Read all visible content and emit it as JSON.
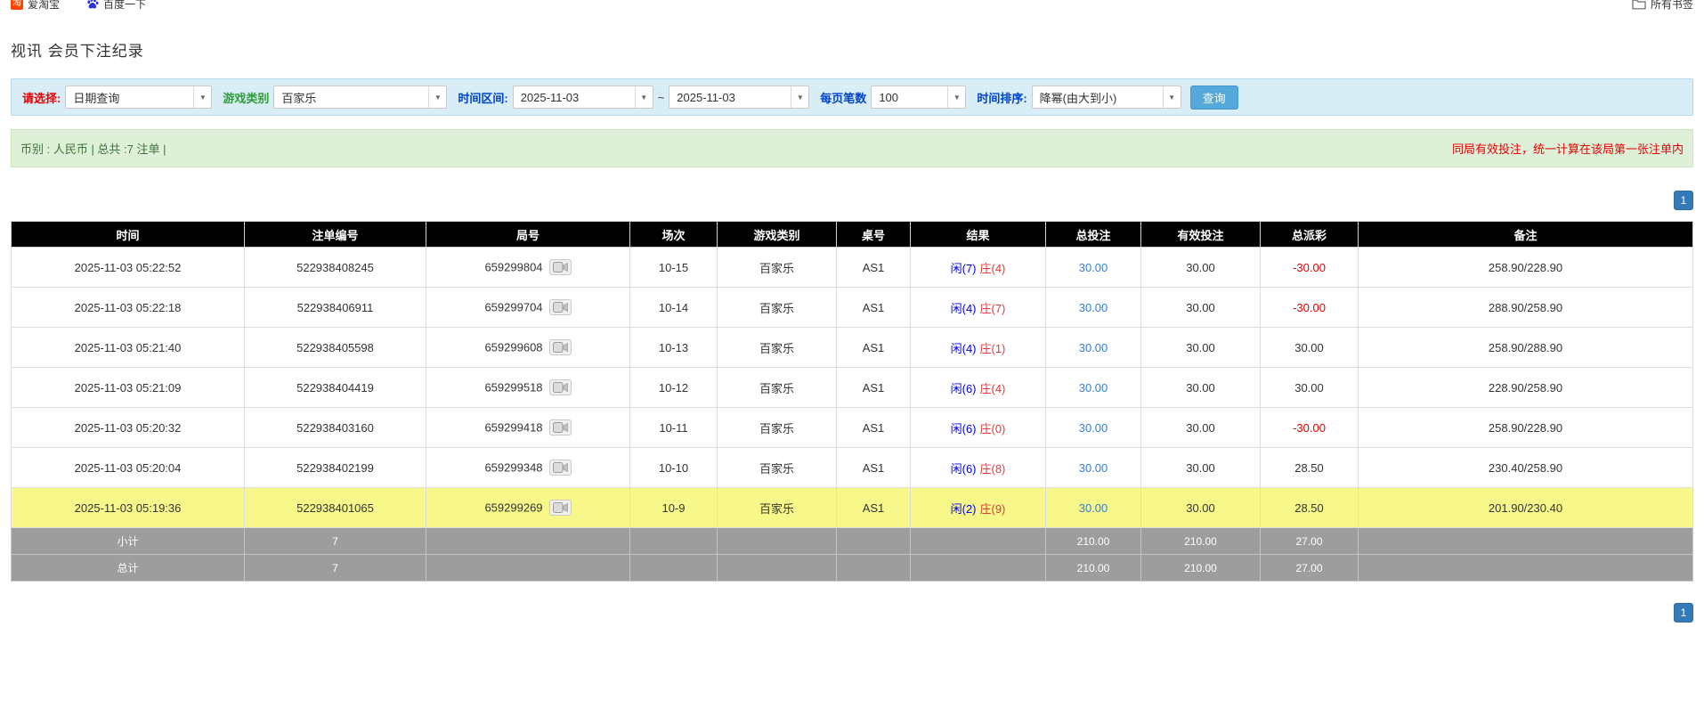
{
  "colors": {
    "header_bg": "#000000",
    "highlight_row": "#f8f88a",
    "summary_bg": "#9d9d9d",
    "link_blue": "#2f7ed8",
    "player_blue": "#0000ee",
    "banker_red": "#e4393c",
    "neg_red": "#e60000",
    "filter_bg": "#d9edf7",
    "filter_border": "#b7d7ea",
    "green_bg": "#dff0d8",
    "green_border": "#cde6bc",
    "green_text": "#3c763d",
    "notice_red": "#e60000",
    "label_red": "#e60000",
    "label_green": "#2e9e36",
    "label_blue": "#0044cc",
    "btn_bg": "#54a8da",
    "btn_border": "#4498cf",
    "page_btn_bg": "#337ab7"
  },
  "bookmarks_bar": {
    "items": [
      {
        "label": "爱淘宝",
        "icon": "taobao-icon"
      },
      {
        "label": "百度一下",
        "icon": "baidu-paw-icon"
      }
    ],
    "all_bookmarks": "所有书签"
  },
  "page": {
    "title": "视讯 会员下注纪录"
  },
  "filters": {
    "select_label": "请选择:",
    "select_value": "日期查询",
    "game_type_label": "游戏类别",
    "game_type_value": "百家乐",
    "date_range_label": "时间区间:",
    "date_from": "2025-11-03",
    "date_separator": "~",
    "date_to": "2025-11-03",
    "page_size_label": "每页笔数",
    "page_size_value": "100",
    "sort_label": "时间排序:",
    "sort_value": "降幂(由大到小)",
    "search_button": "查询"
  },
  "summary_bar": {
    "left": "币别 : 人民币 | 总共 :7 注单 |",
    "right": "同局有效投注，统一计算在该局第一张注单内"
  },
  "pagination": {
    "page": "1"
  },
  "table": {
    "headers": [
      "时间",
      "注单编号",
      "局号",
      "场次",
      "游戏类别",
      "桌号",
      "结果",
      "总投注",
      "有效投注",
      "总派彩",
      "备注"
    ],
    "rows": [
      {
        "time": "2025-11-03 05:22:52",
        "bet_id": "522938408245",
        "round_id": "659299804",
        "session": "10-15",
        "game": "百家乐",
        "table_no": "AS1",
        "result_player": "闲(7)",
        "result_banker": "庄(4)",
        "total_bet": "30.00",
        "valid_bet": "30.00",
        "payout": "-30.00",
        "remark": "258.90/228.90",
        "highlight": false
      },
      {
        "time": "2025-11-03 05:22:18",
        "bet_id": "522938406911",
        "round_id": "659299704",
        "session": "10-14",
        "game": "百家乐",
        "table_no": "AS1",
        "result_player": "闲(4)",
        "result_banker": "庄(7)",
        "total_bet": "30.00",
        "valid_bet": "30.00",
        "payout": "-30.00",
        "remark": "288.90/258.90",
        "highlight": false
      },
      {
        "time": "2025-11-03 05:21:40",
        "bet_id": "522938405598",
        "round_id": "659299608",
        "session": "10-13",
        "game": "百家乐",
        "table_no": "AS1",
        "result_player": "闲(4)",
        "result_banker": "庄(1)",
        "total_bet": "30.00",
        "valid_bet": "30.00",
        "payout": "30.00",
        "remark": "258.90/288.90",
        "highlight": false
      },
      {
        "time": "2025-11-03 05:21:09",
        "bet_id": "522938404419",
        "round_id": "659299518",
        "session": "10-12",
        "game": "百家乐",
        "table_no": "AS1",
        "result_player": "闲(6)",
        "result_banker": "庄(4)",
        "total_bet": "30.00",
        "valid_bet": "30.00",
        "payout": "30.00",
        "remark": "228.90/258.90",
        "highlight": false
      },
      {
        "time": "2025-11-03 05:20:32",
        "bet_id": "522938403160",
        "round_id": "659299418",
        "session": "10-11",
        "game": "百家乐",
        "table_no": "AS1",
        "result_player": "闲(6)",
        "result_banker": "庄(0)",
        "total_bet": "30.00",
        "valid_bet": "30.00",
        "payout": "-30.00",
        "remark": "258.90/228.90",
        "highlight": false
      },
      {
        "time": "2025-11-03 05:20:04",
        "bet_id": "522938402199",
        "round_id": "659299348",
        "session": "10-10",
        "game": "百家乐",
        "table_no": "AS1",
        "result_player": "闲(6)",
        "result_banker": "庄(8)",
        "total_bet": "30.00",
        "valid_bet": "30.00",
        "payout": "28.50",
        "remark": "230.40/258.90",
        "highlight": false
      },
      {
        "time": "2025-11-03 05:19:36",
        "bet_id": "522938401065",
        "round_id": "659299269",
        "session": "10-9",
        "game": "百家乐",
        "table_no": "AS1",
        "result_player": "闲(2)",
        "result_banker": "庄(9)",
        "total_bet": "30.00",
        "valid_bet": "30.00",
        "payout": "28.50",
        "remark": "201.90/230.40",
        "highlight": true
      }
    ],
    "subtotal": {
      "label": "小计",
      "count": "7",
      "total_bet": "210.00",
      "valid_bet": "210.00",
      "payout": "27.00"
    },
    "total": {
      "label": "总计",
      "count": "7",
      "total_bet": "210.00",
      "valid_bet": "210.00",
      "payout": "27.00"
    }
  }
}
